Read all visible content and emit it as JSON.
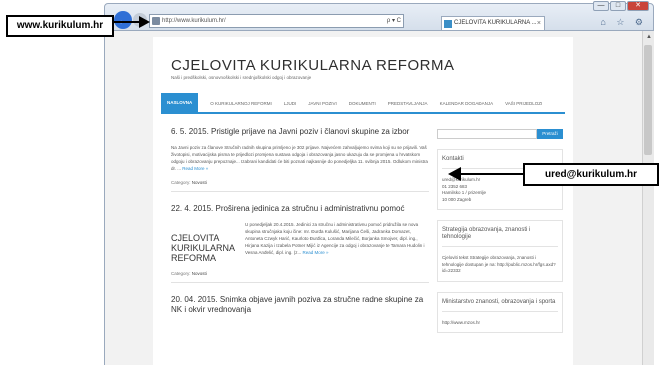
{
  "overlay": {
    "url_label": "www.kurikulum.hr",
    "email_label": "ured@kurikulum.hr"
  },
  "browser": {
    "address": "http://www.kurikulum.hr/",
    "address_tools": "ρ ▾ C",
    "tab_label": "CJELOVITA KURIKULARNA ...",
    "window_controls": [
      "—",
      "□",
      "✕"
    ],
    "toolbar_icons": "⌂ ☆ ⚙"
  },
  "site": {
    "title": "CJELOVITA KURIKULARNA REFORMA",
    "tagline": "Naši i predškolski, osnovnoškolski i srednjoškolski odgoj i obrazovanje",
    "nav": [
      "NASLOVNA",
      "O KURIKULARNOJ REFORMI",
      "LJUDI",
      "JAVNI POZIVI",
      "DOKUMENTI",
      "PREDSTAVLJANJA",
      "KALENDAR DOGAĐANJA",
      "VAŠI PRIJEDLOZI"
    ]
  },
  "posts": [
    {
      "title": "6. 5. 2015. Pristigle prijave na Javni poziv i članovi skupine za izbor",
      "body": "Na Javni poziv za članove Stručnih radnih skupina primljeno je 302 prijave. Najvećem zahvaljujemo svima koji su se prijavili. Vaš životopisi, motivacijska pisma te prijedlozi promjena sustava odgoja i obrazovanja jasno ukazuju da se promjena u hrvatskom odgoju i obrazovanju prepoznaje... Izabrani kandidati će biti poznati najkasnije do ponedjeljka 11. svibnja 2015. Odlukom ministra dr. ...",
      "read_more": "Read More »",
      "category_label": "Category:",
      "category": "Novosti"
    },
    {
      "title": "22. 4. 2015. Proširena jedinica za stručnu i administrativnu pomoć",
      "logo_lines": [
        "CJELOVITA",
        "KURIKULARNA",
        "REFORMA"
      ],
      "body": "U ponedjeljak 20.4.2015. Jedinici za stručnu i administrativnu pomoć pridružila se nova skupina stručnjaka koju čine: mr. Đurđa Kulušić, Marijana Češi, Jadranka Domazet, Antoneta Czwyk Harić, Kaurloto Đurđica, Loranda Milečić, Borjanka Smojver, dipl. ing., Hirjana Kazija i Izabela Potner Mijić iz Agencije za odgoj i obrazovanje te Tamara Hudolin i Vesna Anđelić, dipl. ing. (z... ",
      "read_more": "Read More »",
      "category_label": "Category:",
      "category": "Novosti"
    },
    {
      "title": "20. 04. 2015. Snimka objave javnih poziva za stručne radne skupine za NK i okvir vrednovanja"
    }
  ],
  "sidebar": {
    "search_button": "Pretraži",
    "contacts_title": "Kontakti",
    "contacts_lines": [
      "ured@kurikulum.hr",
      "01 2352 683",
      "Hamilsko 1 / prizemlje",
      "10 000 Zagreb"
    ],
    "strategy_title": "Strategija obrazovanja, znanosti i tehnologije",
    "strategy_body": "Cjeloviti tekst Strategije obrazovanja, znanosti i tehnologije dostupan je na: http://public.mzos.hr/fgs.axd?id=22332",
    "ministry_title": "Ministarstvo znanosti, obrazovanja i sporta",
    "ministry_link": "http://www.mzos.hr"
  },
  "colors": {
    "accent": "#2b8fd1",
    "back_button": "#2f6fd6"
  },
  "icons": [
    "back-arrow-icon",
    "forward-arrow-icon",
    "favicon-icon",
    "home-icon",
    "star-icon",
    "gear-icon",
    "scroll-up-icon"
  ]
}
